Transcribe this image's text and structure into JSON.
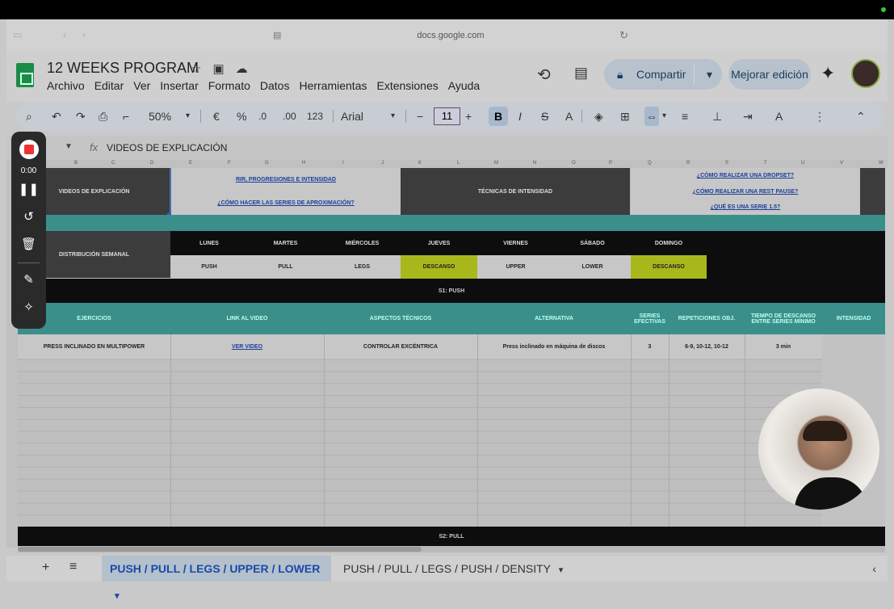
{
  "browser": {
    "url": "docs.google.com"
  },
  "doc": {
    "title": "12 WEEKS PROGRAM"
  },
  "menu": [
    "Archivo",
    "Editar",
    "Ver",
    "Insertar",
    "Formato",
    "Datos",
    "Herramientas",
    "Extensiones",
    "Ayuda"
  ],
  "share": {
    "label": "Compartir"
  },
  "upgrade": {
    "label": "Mejorar edición"
  },
  "toolbar": {
    "zoom": "50%",
    "currency": "€",
    "percent": "%",
    "dec_less": ".0",
    "dec_more": ".00",
    "number_format": "123",
    "font": "Arial",
    "font_size": "11",
    "bold": "B",
    "italic": "I",
    "strike": "S",
    "text_color": "A"
  },
  "formula": {
    "fx": "fx",
    "content": "VIDEOS DE EXPLICACIÓN"
  },
  "columns": [
    "B",
    "C",
    "D",
    "E",
    "F",
    "G",
    "H",
    "I",
    "J",
    "K",
    "L",
    "M",
    "N",
    "O",
    "P",
    "Q",
    "R",
    "S",
    "T",
    "U",
    "V",
    "W"
  ],
  "sheet": {
    "videos_label": "VIDEOS DE EXPLICACIÓN",
    "link_rir": "RIR, PROGRESIONES E INTENSIDAD",
    "link_aprox": "¿CÓMO HACER LAS SERIES DE APROXIMACIÓN?",
    "tecnicas": "TÉCNICAS DE INTENSIDAD",
    "link_dropset": "¿CÓMO REALIZAR UNA DROPSET?",
    "link_restpause": "¿CÓMO REALIZAR UNA REST PAUSE?",
    "link_serie15": "¿QUÉ ES UNA SERIE 1.5?",
    "distribucion": "DISTRIBUCIÓN SEMANAL",
    "days": [
      "LUNES",
      "MARTES",
      "MIÉRCOLES",
      "JUEVES",
      "VIERNES",
      "SÁBADO",
      "DOMINGO"
    ],
    "routine": [
      "PUSH",
      "PULL",
      "LEGS",
      "DESCANSO",
      "UPPER",
      "LOWER",
      "DESCANSO"
    ],
    "s1": "S1: PUSH",
    "headers": [
      "EJERCICIOS",
      "LINK AL VIDEO",
      "ASPECTOS TÉCNICOS",
      "ALTERNATIVA",
      "SERIES EFECTIVAS",
      "REPETICIONES OBJ.",
      "TIEMPO DE DESCANSO ENTRE SERIES MÍNIMO",
      "INTENSIDAD"
    ],
    "row": [
      "PRESS INCLINADO EN MULTIPOWER",
      "VER VIDEO",
      "CONTROLAR EXCÉNTRICA",
      "Press inclinado en máquina de discos",
      "3",
      "6-9, 10-12, 10-12",
      "3 min"
    ],
    "s2": "S2: PULL"
  },
  "recorder": {
    "time": "0:00"
  },
  "tabs": [
    {
      "label": "PUSH / PULL / LEGS / UPPER / LOWER",
      "active": true
    },
    {
      "label": "PUSH / PULL / LEGS / PUSH / DENSITY",
      "active": false
    }
  ]
}
